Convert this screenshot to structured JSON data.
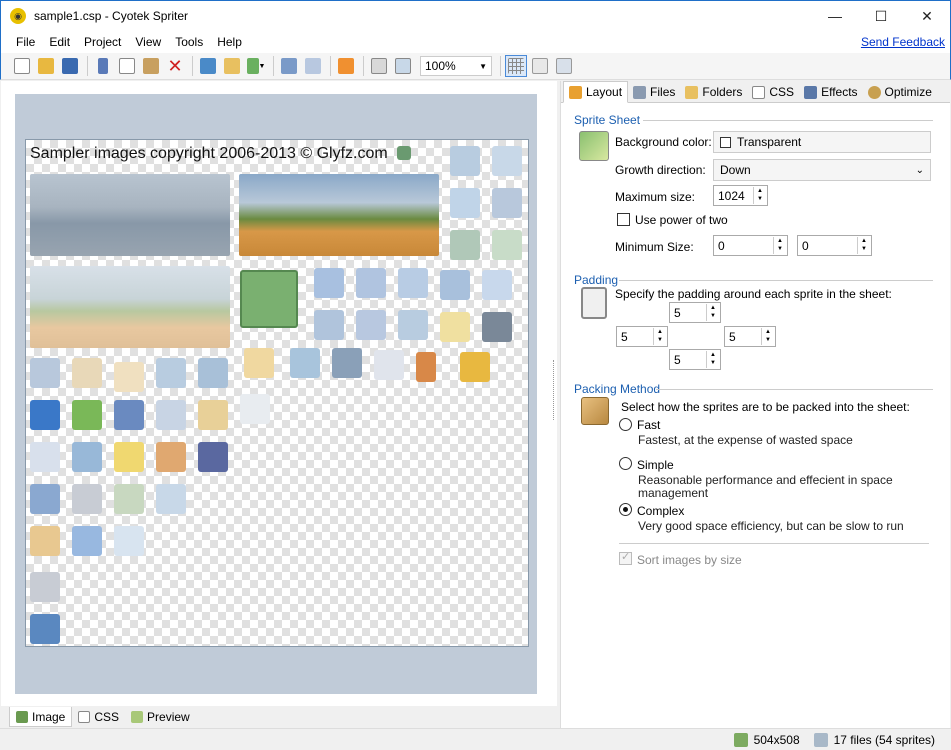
{
  "window": {
    "title": "sample1.csp - Cyotek Spriter",
    "minimize": "—",
    "maximize": "☐",
    "close": "✕"
  },
  "menu": {
    "items": [
      "File",
      "Edit",
      "Project",
      "View",
      "Tools",
      "Help"
    ],
    "feedback": "Send Feedback"
  },
  "toolbar": {
    "zoom": "100%",
    "buttons": [
      "new-icon",
      "open-icon",
      "save-icon",
      "cut-icon",
      "copy-icon",
      "paste-icon",
      "delete-icon",
      "add-image-icon",
      "add-folder-icon",
      "add-dropdown-icon",
      "export-icon",
      "import-icon",
      "generate-icon",
      "zoom-fit-icon",
      "zoom-actual-icon",
      "grid-icon",
      "view-mode-icon",
      "list-icon"
    ]
  },
  "canvas": {
    "copyright": "Sampler images copyright 2006-2013 © Glyfz.com"
  },
  "bottom_tabs": [
    "Image",
    "CSS",
    "Preview"
  ],
  "right_tabs": [
    "Layout",
    "Files",
    "Folders",
    "CSS",
    "Effects",
    "Optimize"
  ],
  "sprite_sheet": {
    "header": "Sprite Sheet",
    "bg_label": "Background color:",
    "bg_value": "Transparent",
    "growth_label": "Growth direction:",
    "growth_value": "Down",
    "max_label": "Maximum size:",
    "max_value": "1024",
    "power_label": "Use power of two",
    "min_label": "Minimum Size:",
    "min_w": "0",
    "min_h": "0"
  },
  "padding": {
    "header": "Padding",
    "desc": "Specify the padding around each sprite in the sheet:",
    "top": "5",
    "left": "5",
    "right": "5",
    "bottom": "5"
  },
  "packing": {
    "header": "Packing Method",
    "desc": "Select how the sprites are to be packed into the sheet:",
    "fast_label": "Fast",
    "fast_desc": "Fastest, at the expense of wasted space",
    "simple_label": "Simple",
    "simple_desc_1": "Reasonable performance and effecient in space",
    "simple_desc_2": "management",
    "complex_label": "Complex",
    "complex_desc": "Very good space efficiency, but can be slow to run",
    "sort_label": "Sort images by size",
    "selected": "Complex"
  },
  "status": {
    "size": "504x508",
    "files": "17 files (54 sprites)"
  }
}
